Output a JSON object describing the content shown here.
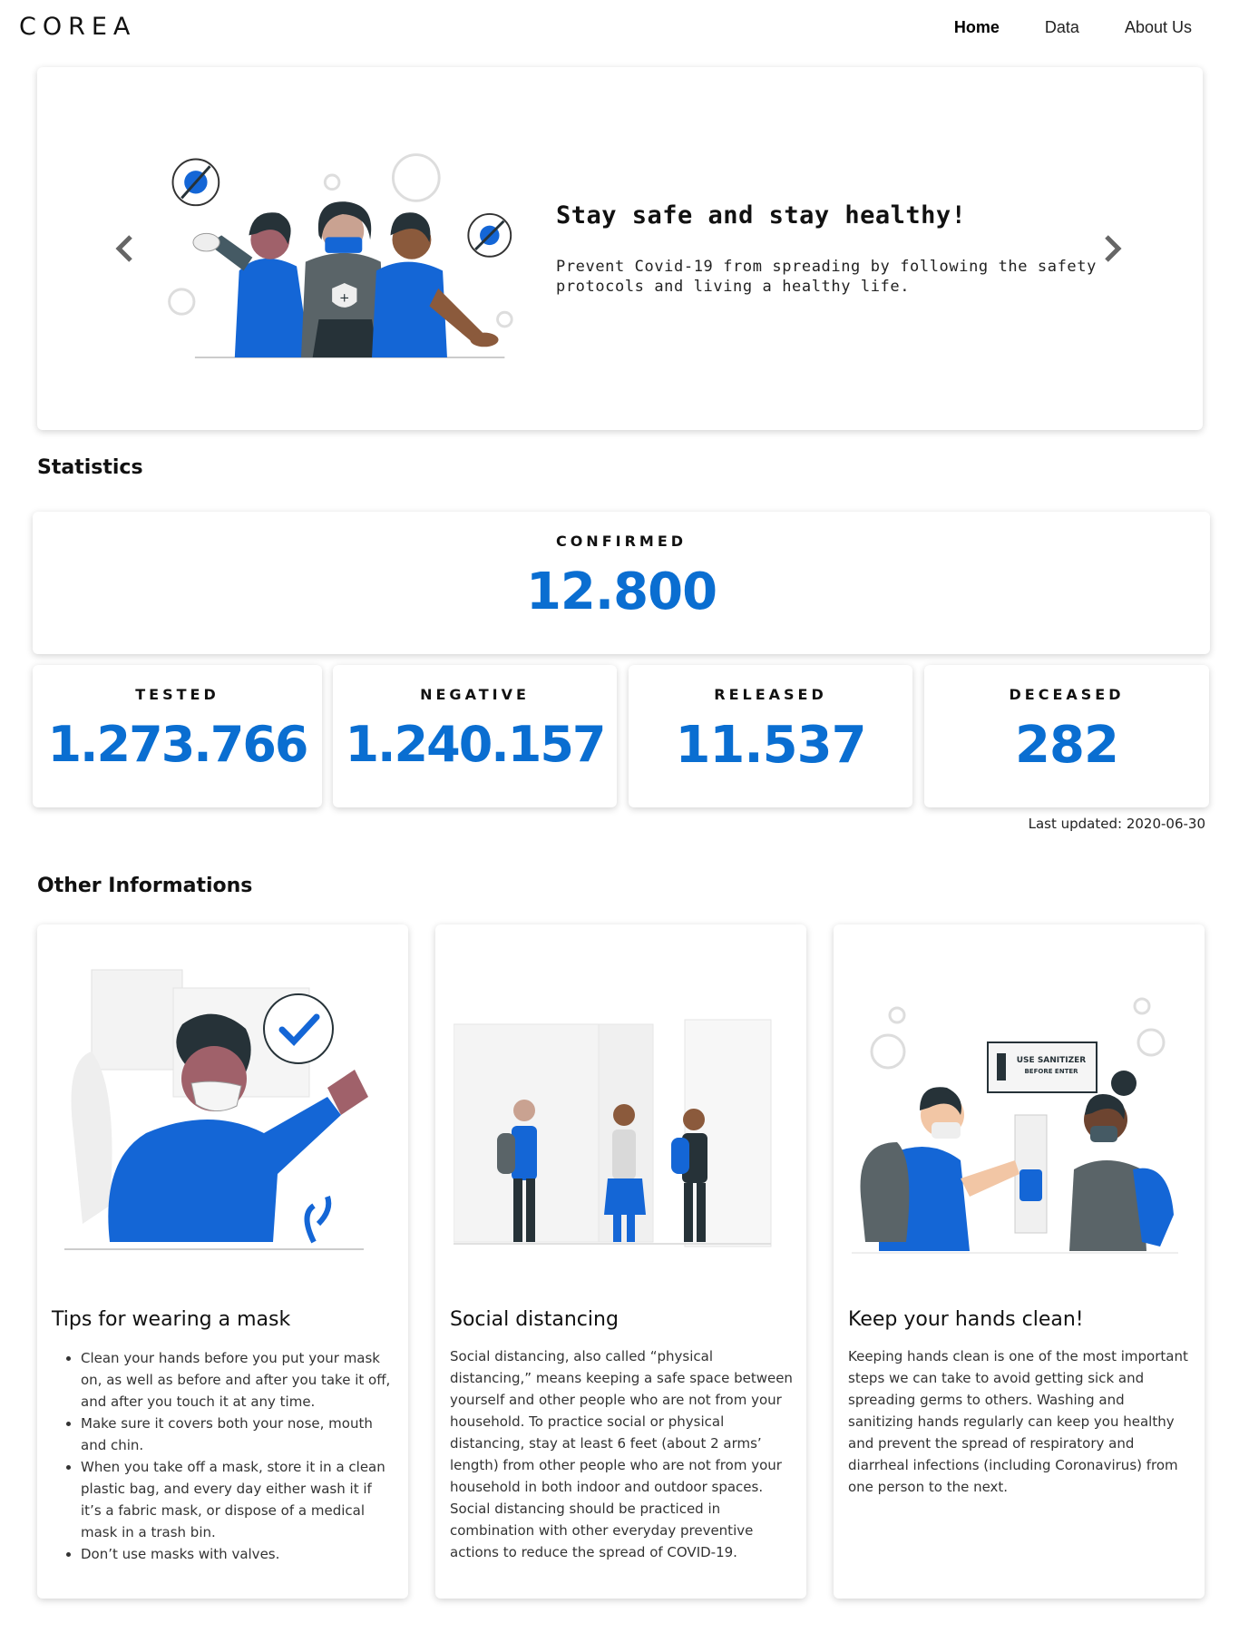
{
  "header": {
    "logo": "COREA",
    "nav": [
      "Home",
      "Data",
      "About Us"
    ]
  },
  "hero": {
    "title": "Stay safe and stay healthy!",
    "text": "Prevent Covid-19 from spreading by following the safety protocols and living a healthy life."
  },
  "statistics": {
    "section_title": "Statistics",
    "confirmed": {
      "label": "CONFIRMED",
      "value": "12.800"
    },
    "tested": {
      "label": "TESTED",
      "value": "1.273.766"
    },
    "negative": {
      "label": "NEGATIVE",
      "value": "1.240.157"
    },
    "released": {
      "label": "RELEASED",
      "value": "11.537"
    },
    "deceased": {
      "label": "DECEASED",
      "value": "282"
    },
    "last_updated": "Last updated: 2020-06-30"
  },
  "other": {
    "section_title": "Other Informations",
    "mask": {
      "title": "Tips for wearing a mask",
      "items": [
        "Clean your hands before you put your mask on, as well as before and after you take it off, and after you touch it at any time.",
        "Make sure it covers both your nose, mouth and chin.",
        "When you take off a mask, store it in a clean plastic bag, and every day either wash it if it’s a fabric mask, or dispose of a medical mask in a trash bin.",
        "Don’t use masks with valves."
      ]
    },
    "distancing": {
      "title": "Social distancing",
      "text": "Social distancing, also called “physical distancing,” means keeping a safe space between yourself and other people who are not from your household. To practice social or physical distancing, stay at least 6 feet (about 2 arms’ length) from other people who are not from your household in both indoor and outdoor spaces. Social distancing should be practiced in combination with other everyday preventive actions to reduce the spread of COVID-19."
    },
    "hands": {
      "title": "Keep your hands clean!",
      "text": "Keeping hands clean is one of the most important steps we can take to avoid getting sick and spreading germs to others. Washing and sanitizing hands regularly can keep you healthy and prevent the spread of respiratory and diarrheal infections (including Coronavirus) from one person to the next.",
      "sign": "USE SANITIZER BEFORE ENTER"
    }
  },
  "colors": {
    "accent": "#0a6ed1",
    "illustration_blue": "#1466d6",
    "dark": "#263238"
  }
}
